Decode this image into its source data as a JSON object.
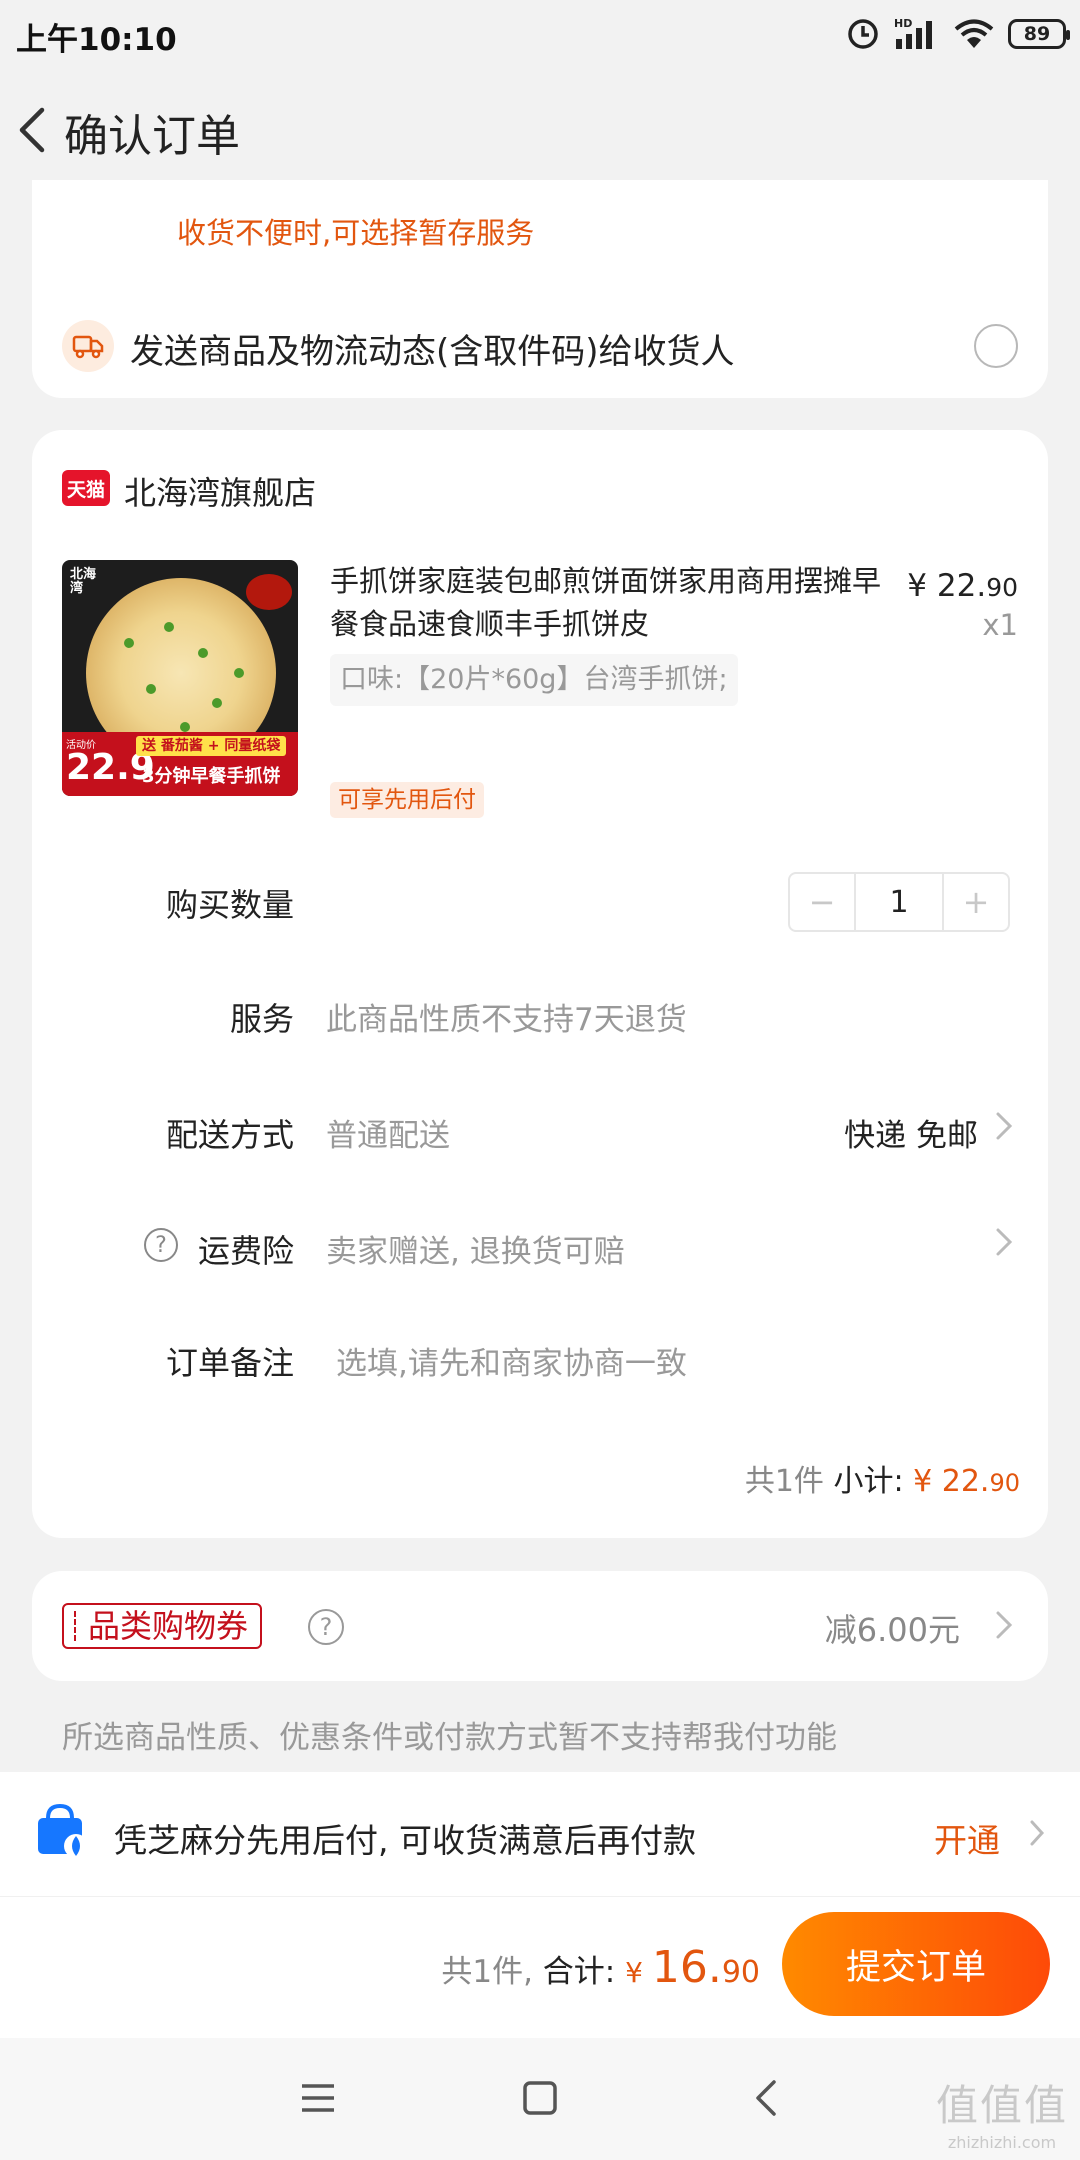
{
  "status_bar": {
    "time": "上午10:10",
    "network": "HD",
    "battery": "89"
  },
  "header": {
    "title": "确认订单"
  },
  "delivery": {
    "notice": "收货不便时,可选择暂存服务",
    "send_info": "发送商品及物流动态(含取件码)给收货人"
  },
  "shop": {
    "badge": "天猫",
    "name": "北海湾旗舰店"
  },
  "product": {
    "title": "手抓饼家庭装包邮煎饼面饼家用商用摆摊早餐食品速食顺丰手抓饼皮",
    "price_int": "¥ 22.",
    "price_dec": "90",
    "quantity": "x1",
    "sku": "口味:【20片*60g】台湾手抓饼;",
    "badge": "可享先用后付",
    "image": {
      "brand": "北海湾",
      "gift": "送 番茄酱 + 同量纸袋",
      "tag": "活动价",
      "price": "22.9",
      "slogan": "3分钟早餐手抓饼"
    }
  },
  "rows": {
    "qty_label": "购买数量",
    "qty_value": "1",
    "minus": "−",
    "plus": "+",
    "service_label": "服务",
    "service_value": "此商品性质不支持7天退货",
    "ship_label": "配送方式",
    "ship_value": "普通配送",
    "ship_right": "快递 免邮",
    "insurance_label": "运费险",
    "insurance_value": "卖家赠送, 退换货可赔",
    "note_label": "订单备注",
    "note_placeholder": "选填,请先和商家协商一致"
  },
  "subtotal": {
    "count": "共1件 ",
    "label": "小计: ",
    "int": "¥ 22.",
    "dec": "90"
  },
  "coupon": {
    "label": "品类购物券",
    "value": "减6.00元"
  },
  "pay_note": "所选商品性质、优惠条件或付款方式暂不支持帮我付功能",
  "bottom": {
    "pay_text": "凭芝麻分先用后付, 可收货满意后再付款",
    "open": "开通",
    "count": "共1件, ",
    "total_label": "合计: ",
    "currency": "¥ ",
    "total_int": "16.",
    "total_dec": "90",
    "submit": "提交订单"
  },
  "watermark": {
    "main": "值值值",
    "sub": "zhizhizhi.com"
  },
  "colors": {
    "accent": "#e2560f",
    "tmall_red": "#e5142b",
    "submit_from": "#ff8a00",
    "submit_to": "#fe4a08"
  }
}
